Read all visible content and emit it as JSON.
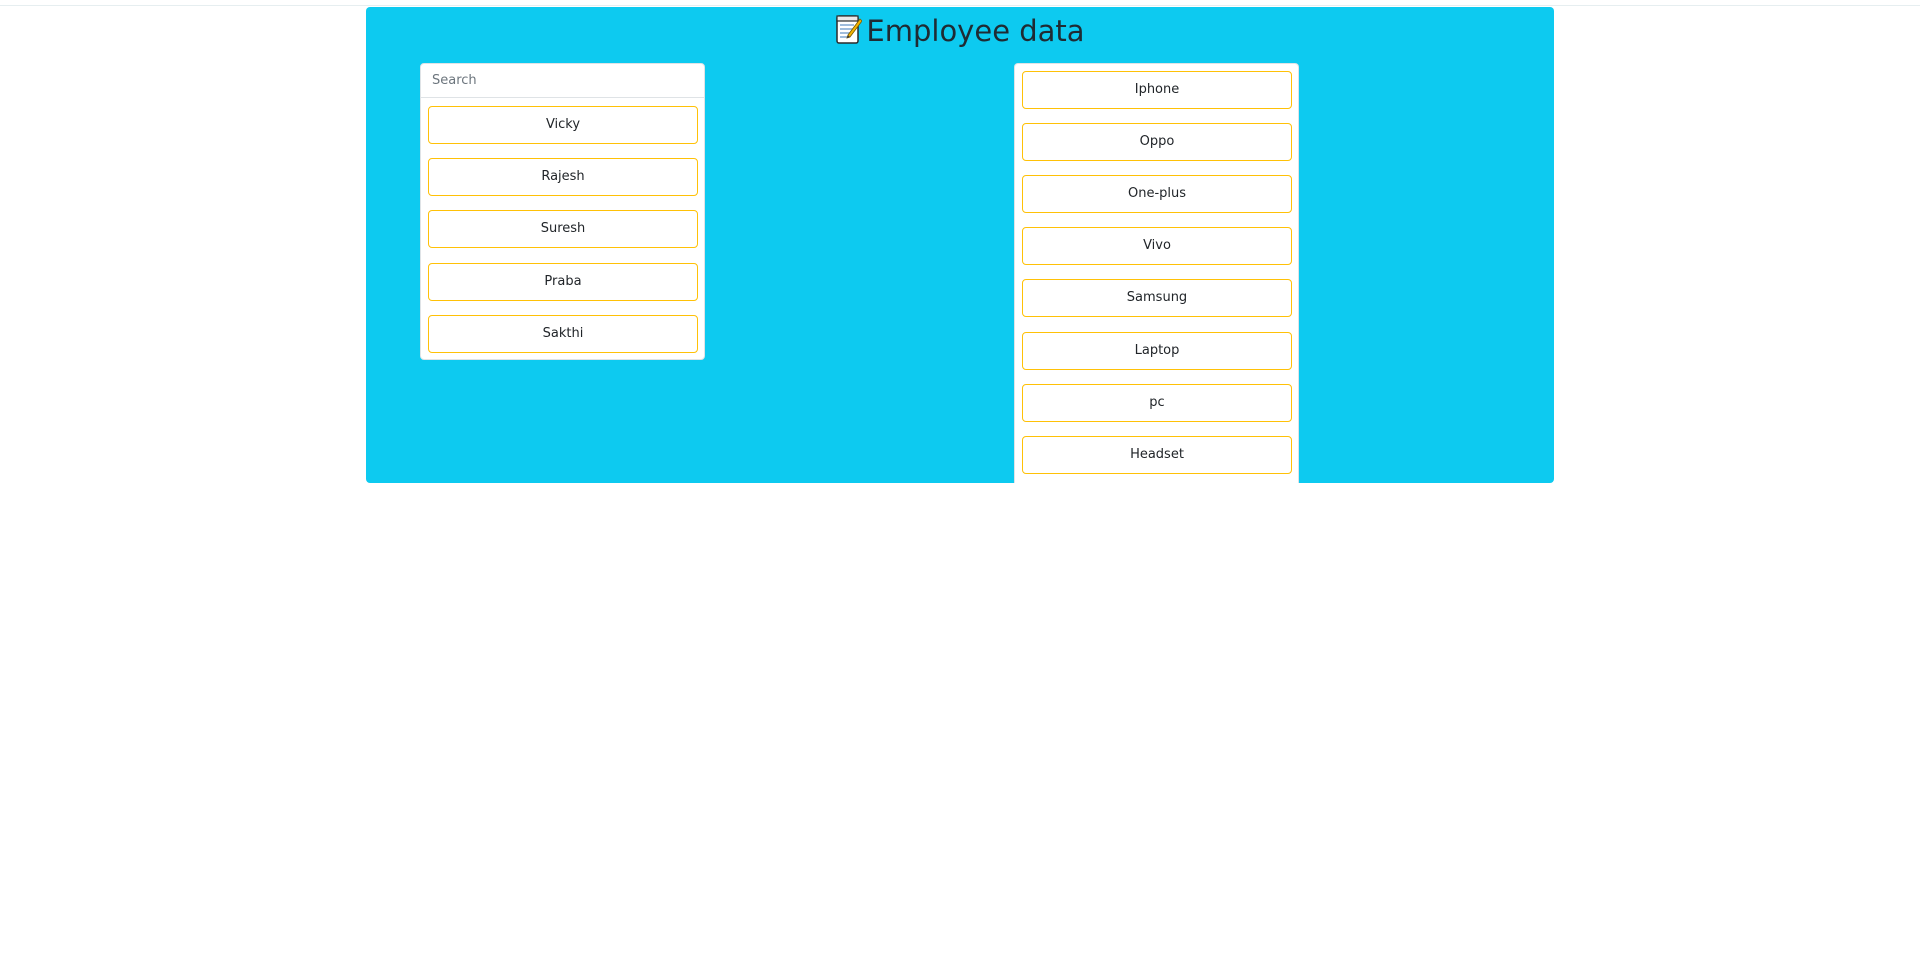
{
  "header": {
    "title": "Employee data",
    "title_icon": "memo-icon"
  },
  "colors": {
    "panel_background": "#0dcaf0",
    "item_border": "#ffc107",
    "title_text": "#1f2b33"
  },
  "employees": {
    "search_placeholder": "Search",
    "search_value": "",
    "items": [
      "Vicky",
      "Rajesh",
      "Suresh",
      "Praba",
      "Sakthi"
    ]
  },
  "products": {
    "items": [
      "Iphone",
      "Oppo",
      "One-plus",
      "Vivo",
      "Samsung",
      "Laptop",
      "pc",
      "Headset"
    ]
  }
}
